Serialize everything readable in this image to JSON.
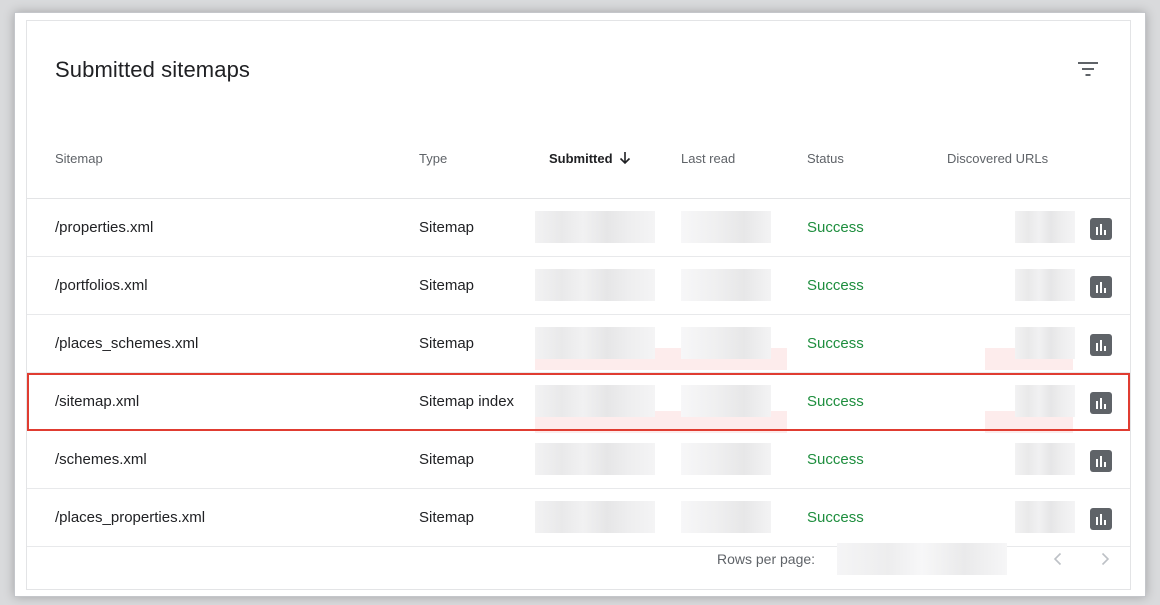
{
  "card": {
    "title": "Submitted sitemaps"
  },
  "icons": {
    "filter": "filter-icon",
    "sort": "arrow-down-icon",
    "chart": "bar-chart-icon",
    "prev": "chevron-left-icon",
    "next": "chevron-right-icon"
  },
  "columns": {
    "sitemap": "Sitemap",
    "type": "Type",
    "submitted": "Submitted",
    "last_read": "Last read",
    "status": "Status",
    "discovered_urls": "Discovered URLs"
  },
  "sort": {
    "column": "submitted",
    "direction": "descending"
  },
  "rows": [
    {
      "sitemap": "/properties.xml",
      "type": "Sitemap",
      "status": "Success"
    },
    {
      "sitemap": "/portfolios.xml",
      "type": "Sitemap",
      "status": "Success"
    },
    {
      "sitemap": "/places_schemes.xml",
      "type": "Sitemap",
      "status": "Success"
    },
    {
      "sitemap": "/sitemap.xml",
      "type": "Sitemap index",
      "status": "Success",
      "highlighted": true
    },
    {
      "sitemap": "/schemes.xml",
      "type": "Sitemap",
      "status": "Success"
    },
    {
      "sitemap": "/places_properties.xml",
      "type": "Sitemap",
      "status": "Success"
    }
  ],
  "footer": {
    "rows_per_page_label": "Rows per page:"
  },
  "colors": {
    "status_success": "#1e8e3e",
    "highlight_border": "#e03c31",
    "action_icon_bg": "#5f6368"
  }
}
